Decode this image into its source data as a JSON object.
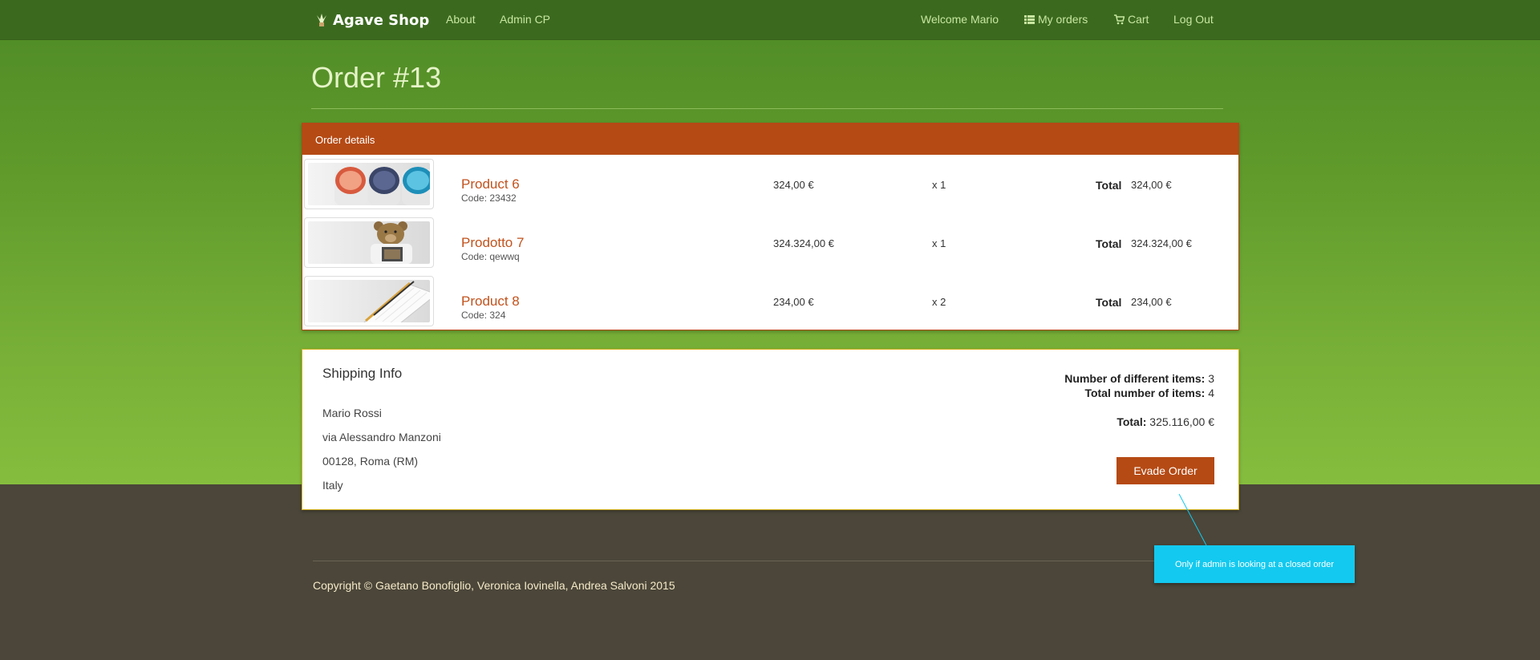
{
  "navbar": {
    "brand": "Agave Shop",
    "links_left": [
      {
        "label": "About"
      },
      {
        "label": "Admin CP"
      }
    ],
    "welcome": "Welcome Mario",
    "my_orders": "My orders",
    "cart": "Cart",
    "logout": "Log Out"
  },
  "page": {
    "title": "Order #13"
  },
  "order_details": {
    "heading": "Order details",
    "rows": [
      {
        "name": "Product 6",
        "code": "Code: 23432",
        "price": "324,00 €",
        "qty": "x 1",
        "total_label": "Total",
        "total": "324,00 €",
        "image": "mugs-image"
      },
      {
        "name": "Prodotto 7",
        "code": "Code: qewwq",
        "price": "324.324,00 €",
        "qty": "x 1",
        "total_label": "Total",
        "total": "324.324,00 €",
        "image": "teddy-bear-image"
      },
      {
        "name": "Product 8",
        "code": "Code: 324",
        "price": "234,00 €",
        "qty": "x 2",
        "total_label": "Total",
        "total": "234,00 €",
        "image": "notepad-image"
      }
    ]
  },
  "shipping": {
    "title": "Shipping Info",
    "name": "Mario Rossi",
    "street": "via Alessandro Manzoni",
    "city": "00128, Roma (RM)",
    "country": "Italy",
    "different_items_label": "Number of different items:",
    "different_items_value": "3",
    "total_items_label": "Total number of items:",
    "total_items_value": "4",
    "total_label": "Total:",
    "total_value": "325.116,00 €",
    "evade_button": "Evade Order"
  },
  "footer": {
    "copyright": "Copyright © Gaetano Bonofiglio, Veronica Iovinella, Andrea Salvoni 2015"
  },
  "annotation": {
    "text": "Only if admin is looking at a closed order"
  },
  "colors": {
    "navbar": "#3b6a1f",
    "accent": "#b54a14",
    "nav_link": "#c8e6a0",
    "footer_bg": "#4b4639",
    "callout": "#13c9ef"
  }
}
